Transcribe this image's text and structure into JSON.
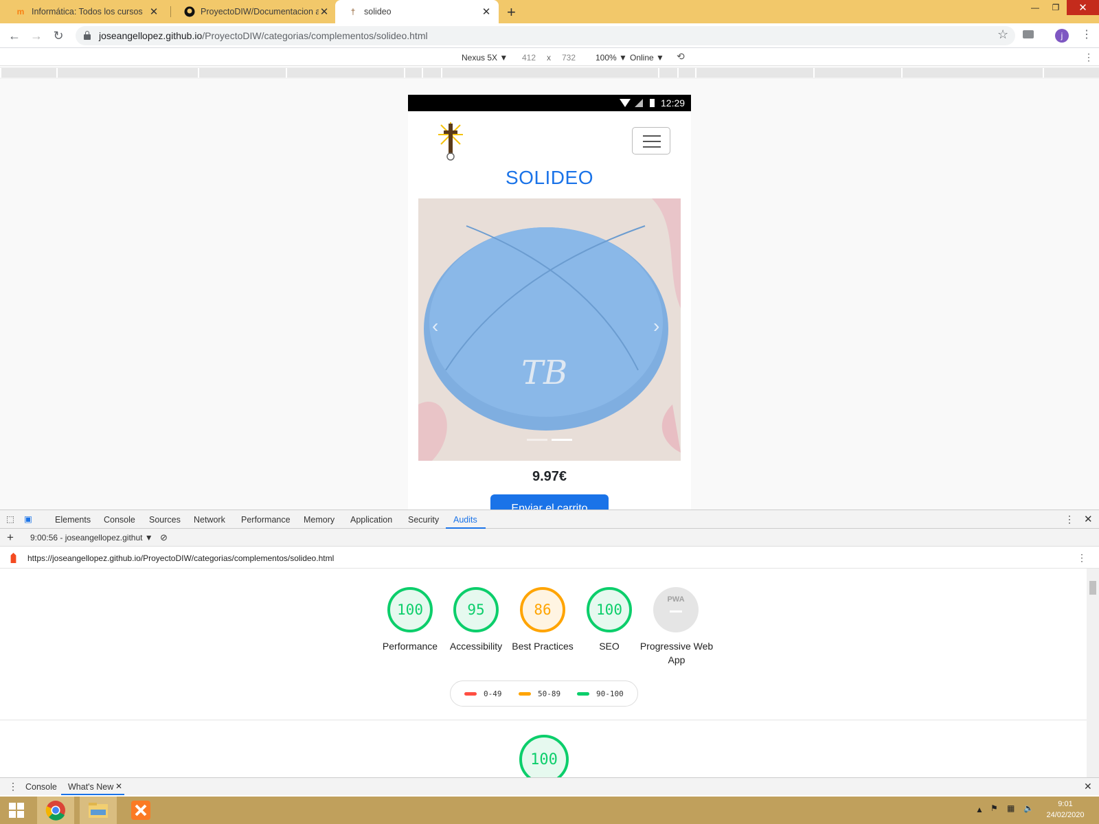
{
  "browser": {
    "tabs": [
      {
        "title": "Informática: Todos los cursos",
        "icon": "moodle-icon"
      },
      {
        "title": "ProyectoDIW/Documentacion at",
        "icon": "github-icon"
      },
      {
        "title": "solideo",
        "icon": "site-logo-icon"
      }
    ],
    "new_tab_symbol": "+",
    "address": {
      "host": "joseangellopez.github.io",
      "path": "/ProyectoDIW/categorias/complementos/solideo.html"
    },
    "profile_initial": "j"
  },
  "device_toolbar": {
    "device": "Nexus 5X",
    "width": "412",
    "times": "x",
    "height": "732",
    "zoom": "100%",
    "network": "Online"
  },
  "phone": {
    "status_time": "12:29",
    "page_title": "SOLIDEO",
    "price": "9.97€",
    "buy_button": "Enviar el carrito",
    "carousel_active_index": 1,
    "carousel_count": 2
  },
  "devtools": {
    "tabs": [
      "Elements",
      "Console",
      "Sources",
      "Network",
      "Performance",
      "Memory",
      "Application",
      "Security",
      "Audits"
    ],
    "active_tab": "Audits",
    "report_select": "9:00:56 - joseangellopez.githut",
    "report_url": "https://joseangellopez.github.io/ProyectoDIW/categorias/complementos/solideo.html",
    "scores": [
      {
        "label": "Performance",
        "value": "100",
        "status": "pass"
      },
      {
        "label": "Accessibility",
        "value": "95",
        "status": "pass"
      },
      {
        "label": "Best Practices",
        "value": "86",
        "status": "average"
      },
      {
        "label": "SEO",
        "value": "100",
        "status": "pass"
      },
      {
        "label": "Progressive Web App",
        "value": "",
        "badge": "PWA",
        "status": "na"
      }
    ],
    "legend": [
      {
        "range": "0-49",
        "color": "#ff4e42"
      },
      {
        "range": "50-89",
        "color": "#ffa400"
      },
      {
        "range": "90-100",
        "color": "#0cce6b"
      }
    ],
    "section_score": "100",
    "drawer_tabs": [
      "Console",
      "What's New"
    ]
  },
  "taskbar": {
    "time": "9:01",
    "date": "24/02/2020"
  }
}
